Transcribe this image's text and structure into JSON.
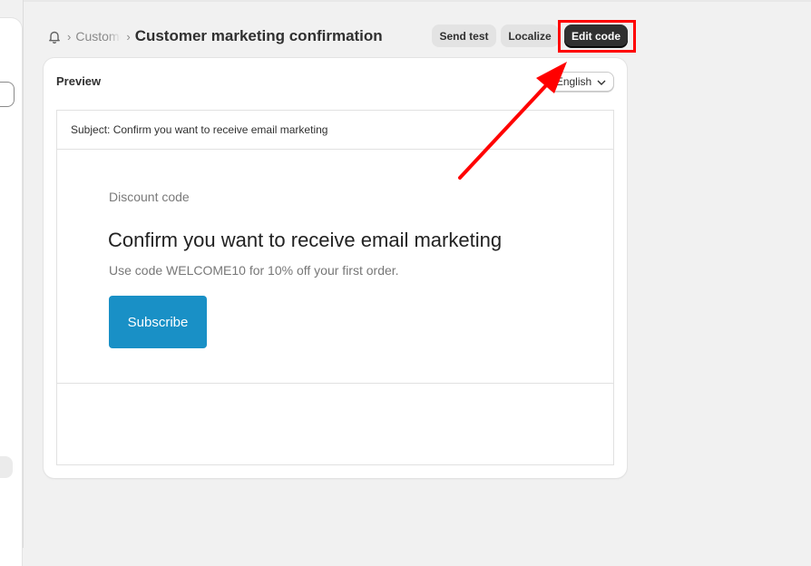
{
  "breadcrumb": {
    "parent": "Customer notifications",
    "title": "Customer marketing confirmation"
  },
  "actions": {
    "send_test": "Send test",
    "localize": "Localize",
    "edit_code": "Edit code"
  },
  "preview": {
    "title": "Preview",
    "language": "English",
    "subject": "Subject: Confirm you want to receive email marketing"
  },
  "email": {
    "shop_name": "Discount code",
    "heading": "Confirm you want to receive email marketing",
    "body": "Use code WELCOME10 for 10% off your first order.",
    "button": "Subscribe"
  },
  "colors": {
    "annotation": "#ff0000",
    "email_button": "#1990c6",
    "primary_button": "#303030"
  }
}
